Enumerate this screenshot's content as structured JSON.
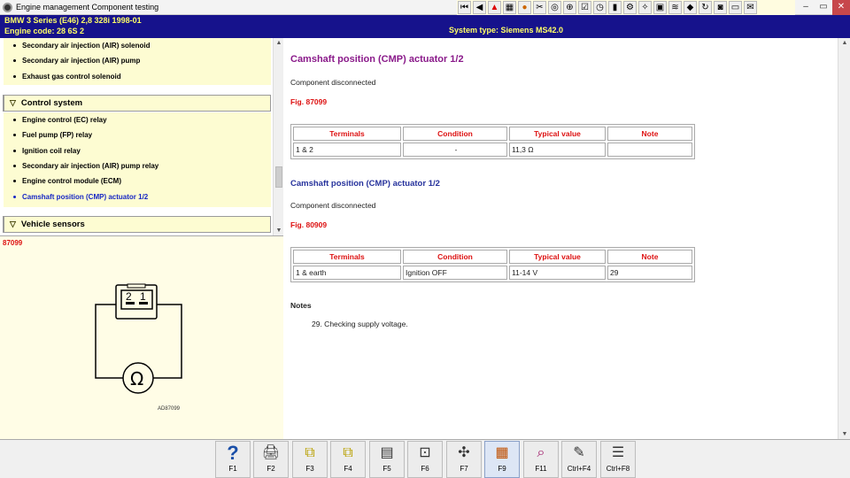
{
  "window": {
    "title": "Engine management Component testing"
  },
  "toolbar": {
    "icons": [
      "first-icon",
      "prev-icon",
      "warning-icon",
      "chart-icon",
      "info-icon",
      "tools-icon",
      "gauge-icon",
      "plug-icon",
      "checklist-icon",
      "clock-icon",
      "battery-icon",
      "engine-icon",
      "wrench-icon",
      "diagram-icon",
      "cable-icon",
      "component-icon",
      "refresh-icon",
      "camera-icon",
      "print-icon",
      "note-icon"
    ]
  },
  "window_controls": {
    "minimize": "–",
    "maximize": "▭",
    "close": "✕"
  },
  "header": {
    "model": "BMW   3 Series (E46) 2,8 328i 1998-01",
    "engine": "Engine code: 28 6S 2",
    "system": "System type: Siemens MS42.0"
  },
  "tree": {
    "group_a_items": [
      {
        "label": "Secondary air injection (AIR) solenoid"
      },
      {
        "label": "Secondary air injection (AIR) pump"
      },
      {
        "label": "Exhaust gas control solenoid"
      }
    ],
    "control_system": {
      "title": "Control system",
      "items": [
        {
          "label": "Engine control (EC) relay"
        },
        {
          "label": "Fuel pump (FP) relay"
        },
        {
          "label": "Ignition coil relay"
        },
        {
          "label": "Secondary air injection (AIR) pump relay"
        },
        {
          "label": "Engine control module (ECM)"
        },
        {
          "label": "Camshaft position (CMP) actuator 1/2"
        }
      ]
    },
    "vehicle_sensors": {
      "title": "Vehicle sensors"
    }
  },
  "diagram": {
    "fig_number": "87099",
    "pin_2": "2",
    "pin_1": "1",
    "meter_symbol": "Ω",
    "code": "AD87099"
  },
  "content": {
    "section1": {
      "title": "Camshaft position (CMP) actuator 1/2",
      "status": "Component disconnected",
      "fig": "Fig. 87099",
      "headers": [
        "Terminals",
        "Condition",
        "Typical value",
        "Note"
      ],
      "rows": [
        [
          "1 & 2",
          "-",
          "11,3 Ω",
          ""
        ]
      ]
    },
    "section2": {
      "title": "Camshaft position (CMP) actuator 1/2",
      "status": "Component disconnected",
      "fig": "Fig. 80909",
      "headers": [
        "Terminals",
        "Condition",
        "Typical value",
        "Note"
      ],
      "rows": [
        [
          "1 & earth",
          "Ignition OFF",
          "11-14 V",
          "29"
        ]
      ]
    },
    "notes": {
      "title": "Notes",
      "items": [
        "29. Checking supply voltage."
      ]
    }
  },
  "function_keys": [
    {
      "key": "F1",
      "icon": "help-icon",
      "glyph": "?"
    },
    {
      "key": "F2",
      "icon": "printer-icon",
      "glyph": "🖨"
    },
    {
      "key": "F3",
      "icon": "copy-icon",
      "glyph": "⧉"
    },
    {
      "key": "F4",
      "icon": "paste-icon",
      "glyph": "⧉"
    },
    {
      "key": "F5",
      "icon": "document-icon",
      "glyph": "▤"
    },
    {
      "key": "F6",
      "icon": "connector-icon",
      "glyph": "⊡"
    },
    {
      "key": "F7",
      "icon": "probe-icon",
      "glyph": "✣"
    },
    {
      "key": "F9",
      "icon": "component-map-icon",
      "glyph": "▦"
    },
    {
      "key": "F11",
      "icon": "search-diagram-icon",
      "glyph": "⌕"
    },
    {
      "key": "Ctrl+F4",
      "icon": "notepad-icon",
      "glyph": "✎"
    },
    {
      "key": "Ctrl+F8",
      "icon": "list-icon",
      "glyph": "☰"
    }
  ]
}
